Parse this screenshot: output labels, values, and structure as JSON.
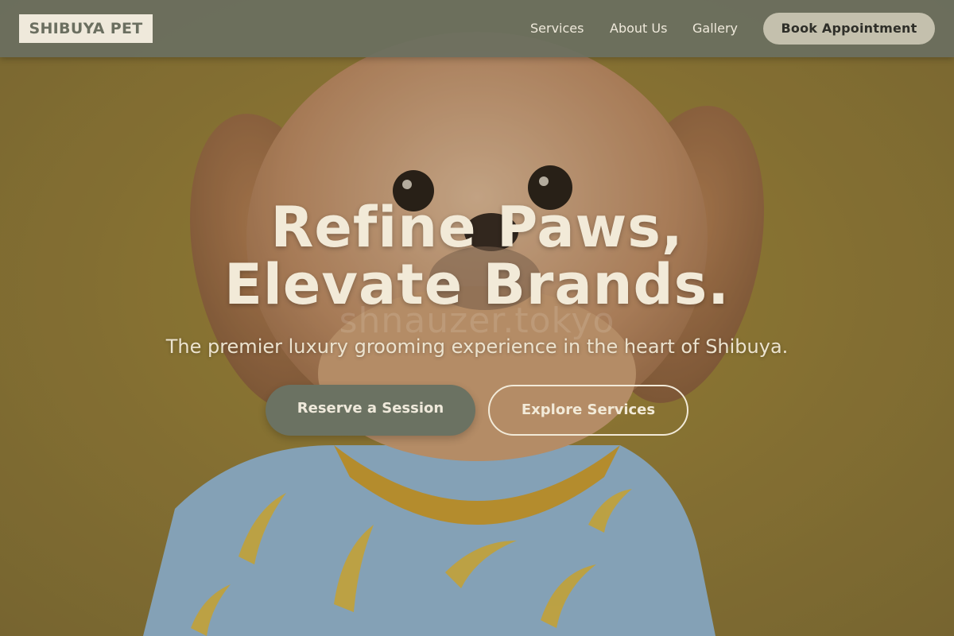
{
  "header": {
    "logo": "SHIBUYA PET",
    "nav": [
      {
        "label": "Services"
      },
      {
        "label": "About Us"
      },
      {
        "label": "Gallery"
      }
    ],
    "cta_label": "Book Appointment"
  },
  "hero": {
    "title_line1": "Refine Paws,",
    "title_line2": "Elevate Brands.",
    "subtitle": "The premier luxury grooming experience in the heart of Shibuya.",
    "primary_button": "Reserve a Session",
    "secondary_button": "Explore Services",
    "image_watermark": "shnauzer.tokyo",
    "image_description_icon": "dog-photo"
  },
  "colors": {
    "header_bg": "#6b6f60",
    "logo_bg": "#efe9db",
    "cta_bg": "#c4c0ad",
    "hero_bg": "#8f7732",
    "text_light": "#f2ead8",
    "primary_button_bg": "#6b7262"
  }
}
